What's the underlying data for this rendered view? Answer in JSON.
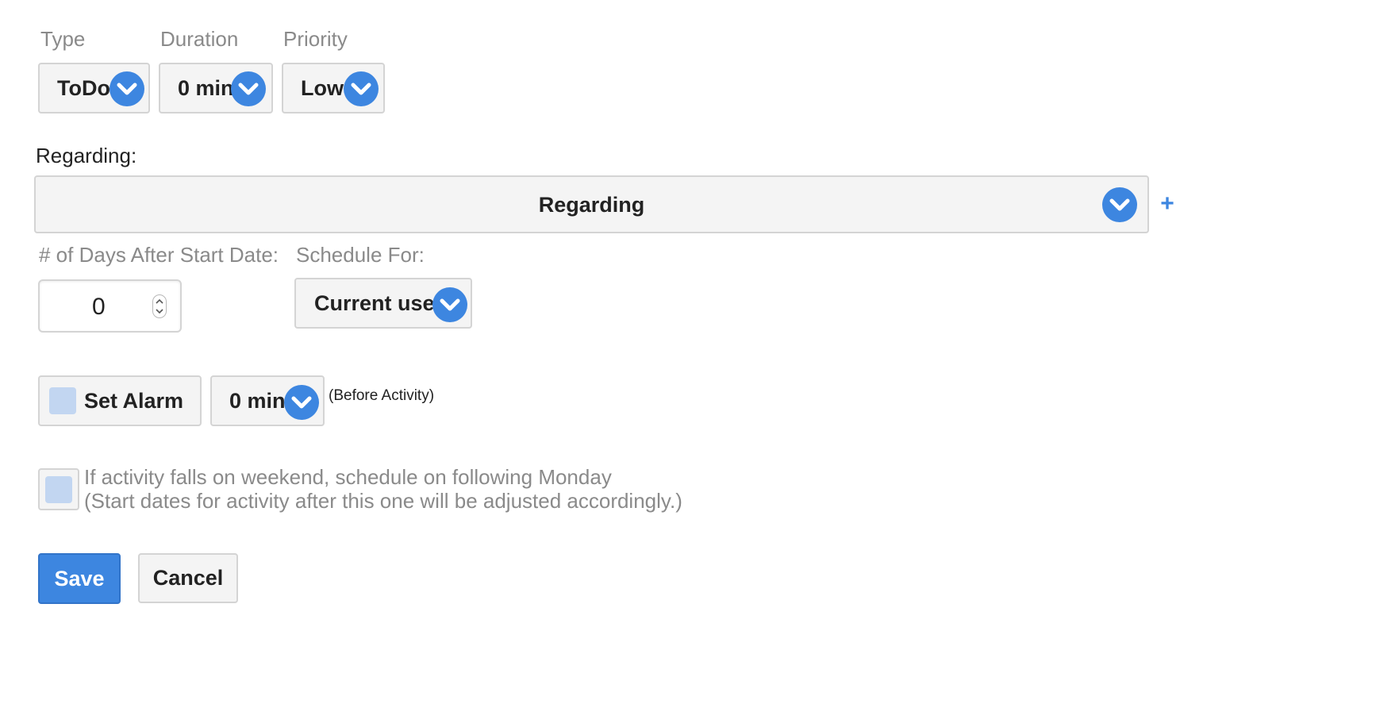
{
  "fields": {
    "type": {
      "label": "Type",
      "value": "ToDo"
    },
    "duration": {
      "label": "Duration",
      "value": "0 min"
    },
    "priority": {
      "label": "Priority",
      "value": "Low"
    }
  },
  "regarding": {
    "label": "Regarding:",
    "value": "Regarding",
    "add_symbol": "+"
  },
  "days_after_start": {
    "label": "# of Days After Start Date:",
    "value": "0"
  },
  "schedule_for": {
    "label": "Schedule For:",
    "value": "Current user"
  },
  "alarm": {
    "checkbox_label": "Set Alarm",
    "time_value": "0 min",
    "note": "(Before Activity)"
  },
  "weekend": {
    "line1": "If activity falls on weekend, schedule on following Monday",
    "line2": "(Start dates for activity after this one will be adjusted accordingly.)"
  },
  "actions": {
    "save_label": "Save",
    "cancel_label": "Cancel"
  },
  "colors": {
    "accent": "#3d86e0",
    "checkbox_fill": "#c2d6f1",
    "button_bg": "#f4f4f4",
    "label_grey": "#8a8a8a"
  },
  "icons": {
    "dropdown": "chevron-down-icon",
    "add": "plus-icon",
    "spinner": "stepper-arrows-icon"
  }
}
